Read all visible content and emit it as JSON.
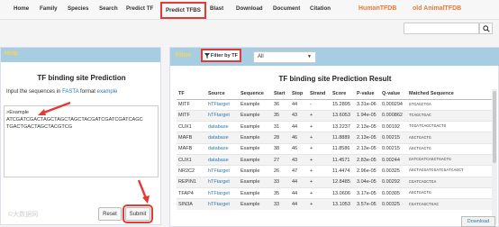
{
  "nav": {
    "items": [
      "Home",
      "Family",
      "Species",
      "Search",
      "Predict TF",
      "Predict TFBS",
      "Blast",
      "Download",
      "Document",
      "Citation"
    ],
    "brand_human": "HumanTFDB",
    "brand_animal": "old AnimalTFDB"
  },
  "colors": {
    "accent_red": "#e53935",
    "brand_orange": "#e8793a",
    "panel_header": "#a7cde3",
    "header_label": "#f7d64c",
    "link": "#2a7ab0"
  },
  "left": {
    "header_label": "Help",
    "title": "TF binding site Prediction",
    "instruction_prefix": "Input the sequences in",
    "instruction_link1": "FASTA",
    "instruction_mid": "format",
    "instruction_link2": "example",
    "sequence_lines": [
      ">Example",
      "ATCGATCGACTAGCTAGCTAGCTACGATCGATCGATCAGC",
      "TGACTGACTAGCTACGTCG"
    ],
    "reset_label": "Reset",
    "submit_label": "Submit",
    "watermark": "©大数据网"
  },
  "right": {
    "header_label": "Filter",
    "filter_button_label": "Filter by TF",
    "filter_select_value": "All",
    "title": "TF binding site Prediction Result",
    "download_label": "Download",
    "columns": [
      "TF",
      "Source",
      "Sequence",
      "Start",
      "Stop",
      "Strand",
      "Score",
      "P-value",
      "Q-value",
      "Matched Sequence"
    ],
    "rows": [
      [
        "MITF",
        "hTFtarget",
        "Example",
        "36",
        "44",
        "-",
        "15.2895",
        "3.31e-06",
        "0.000294",
        "GTCAGCTGA"
      ],
      [
        "MITF",
        "hTFtarget",
        "Example",
        "35",
        "43",
        "+",
        "13.6053",
        "1.94e-05",
        "0.000862",
        "TCAGCTGAC"
      ],
      [
        "CUX1",
        "database",
        "Example",
        "31",
        "44",
        "+",
        "13.2237",
        "2.13e-05",
        "0.00192",
        "TCGATCAGCTGACTG"
      ],
      [
        "MAFB",
        "database",
        "Example",
        "28",
        "46",
        "+",
        "11.8889",
        "2.13e-05",
        "0.00215",
        "AGCTGACTG"
      ],
      [
        "MAFB",
        "database",
        "Example",
        "38",
        "46",
        "+",
        "11.8586",
        "2.13e-05",
        "0.00215",
        "AGCTGACTG"
      ],
      [
        "CUX1",
        "database",
        "Example",
        "27",
        "43",
        "+",
        "11.4571",
        "2.83e-05",
        "0.00244",
        "GATCGATCAGCTGACTG"
      ],
      [
        "NR2C2",
        "hTFtarget",
        "Example",
        "26",
        "47",
        "+",
        "11.4474",
        "2.96e-05",
        "0.00325",
        "AGCTACGATCGATCGATCAGCT"
      ],
      [
        "REPIN1",
        "hTFtarget",
        "Example",
        "33",
        "44",
        "+",
        "12.8485",
        "3.04e-05",
        "0.00292",
        "CGATCAGCTGA"
      ],
      [
        "TFAP4",
        "hTFtarget",
        "Example",
        "35",
        "44",
        "+",
        "13.0606",
        "3.17e-05",
        "0.00305",
        "AGCTGACTG"
      ],
      [
        "SIN3A",
        "hTFtarget",
        "Example",
        "33",
        "44",
        "+",
        "13.1053",
        "3.57e-05",
        "0.00325",
        "CGATCAGCTGAC"
      ]
    ]
  }
}
